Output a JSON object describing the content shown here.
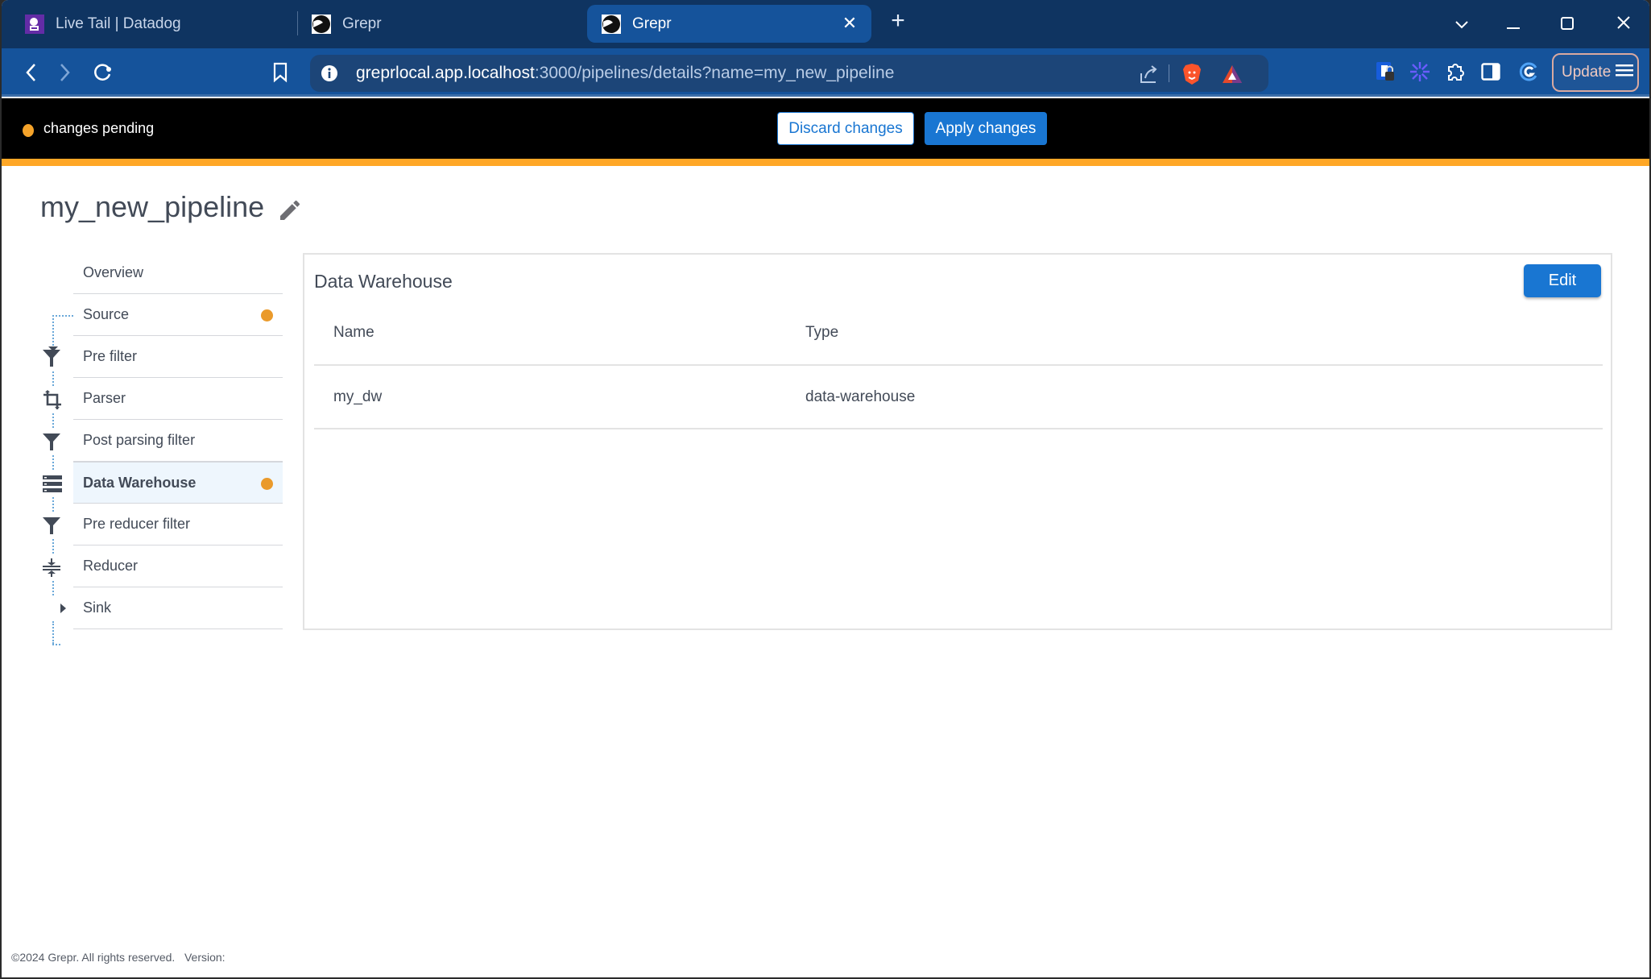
{
  "browser": {
    "tabs": [
      {
        "title": "Live Tail | Datadog",
        "icon": "datadog-icon",
        "active": false
      },
      {
        "title": "Grepr",
        "icon": "grepr-icon",
        "active": false
      },
      {
        "title": "Grepr",
        "icon": "grepr-icon",
        "active": true
      }
    ],
    "close_tab_glyph": "✕",
    "new_tab_glyph": "+",
    "url_host": "greprlocal.app.localhost",
    "url_rest": ":3000/pipelines/details?name=my_new_pipeline",
    "update_label": "Update",
    "window_controls": {
      "tab_search": "⌄",
      "minimize": "—",
      "maximize": "☐",
      "close": "✕"
    }
  },
  "banner": {
    "status_text": "changes pending",
    "status_color": "#f5a32a",
    "discard_label": "Discard changes",
    "apply_label": "Apply changes",
    "accent_color": "#ffa726"
  },
  "pipeline": {
    "name": "my_new_pipeline",
    "steps": [
      {
        "label": "Overview",
        "icon": null,
        "pending": false,
        "active": false
      },
      {
        "label": "Source",
        "icon": null,
        "pending": true,
        "active": false
      },
      {
        "label": "Pre filter",
        "icon": "filter-icon",
        "pending": false,
        "active": false
      },
      {
        "label": "Parser",
        "icon": "crop-icon",
        "pending": false,
        "active": false
      },
      {
        "label": "Post parsing filter",
        "icon": "filter-icon",
        "pending": false,
        "active": false
      },
      {
        "label": "Data Warehouse",
        "icon": "storage-icon",
        "pending": true,
        "active": true
      },
      {
        "label": "Pre reducer filter",
        "icon": "filter-icon",
        "pending": false,
        "active": false
      },
      {
        "label": "Reducer",
        "icon": "compress-icon",
        "pending": false,
        "active": false
      },
      {
        "label": "Sink",
        "icon": "arrow-right-icon",
        "pending": false,
        "active": false
      }
    ]
  },
  "panel": {
    "title": "Data Warehouse",
    "edit_label": "Edit",
    "columns": [
      "Name",
      "Type"
    ],
    "rows": [
      [
        "my_dw",
        "data-warehouse"
      ]
    ]
  },
  "footer": {
    "copyright": "©2024 Grepr. All rights reserved.",
    "version_label": "Version:"
  }
}
